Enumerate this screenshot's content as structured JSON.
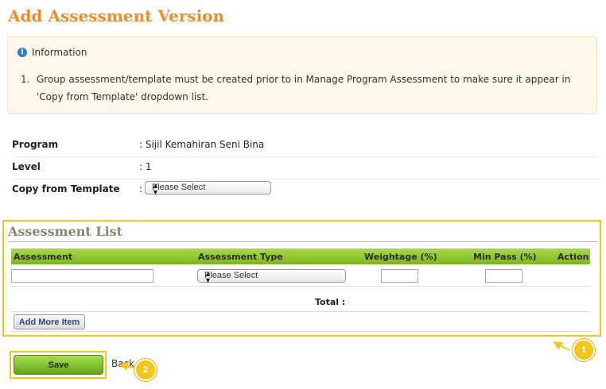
{
  "page": {
    "title": "Add Assessment Version"
  },
  "info": {
    "heading": "Information",
    "icon": "info-icon",
    "items": [
      {
        "number": "1.",
        "text": "Group assessment/template must be created prior to in Manage Program Assessment to make sure it appear in 'Copy from Template' dropdown list."
      }
    ]
  },
  "form": {
    "program": {
      "label": "Program",
      "value": ": Sijil Kemahiran Seni Bina"
    },
    "level": {
      "label": "Level",
      "value": ": 1"
    },
    "copy_template": {
      "label": "Copy from Template",
      "colon": ":",
      "selected": "Please Select"
    }
  },
  "assessment_list": {
    "title": "Assessment List",
    "columns": [
      "Assessment",
      "Assessment Type",
      "Weightage (%)",
      "Min Pass (%)",
      "Action"
    ],
    "row": {
      "assessment": "",
      "type_selected": "Please Select",
      "weightage": "",
      "min_pass": ""
    },
    "total_label": "Total :",
    "add_button": "Add More Item"
  },
  "actions": {
    "save_label": "Save",
    "back_label": "Back"
  },
  "callouts": [
    "1",
    "2"
  ],
  "colors": {
    "title": "#f28c28",
    "highlight": "#f5c518",
    "table_header": "#8cc63f",
    "save_button": "#7fbf2a"
  }
}
